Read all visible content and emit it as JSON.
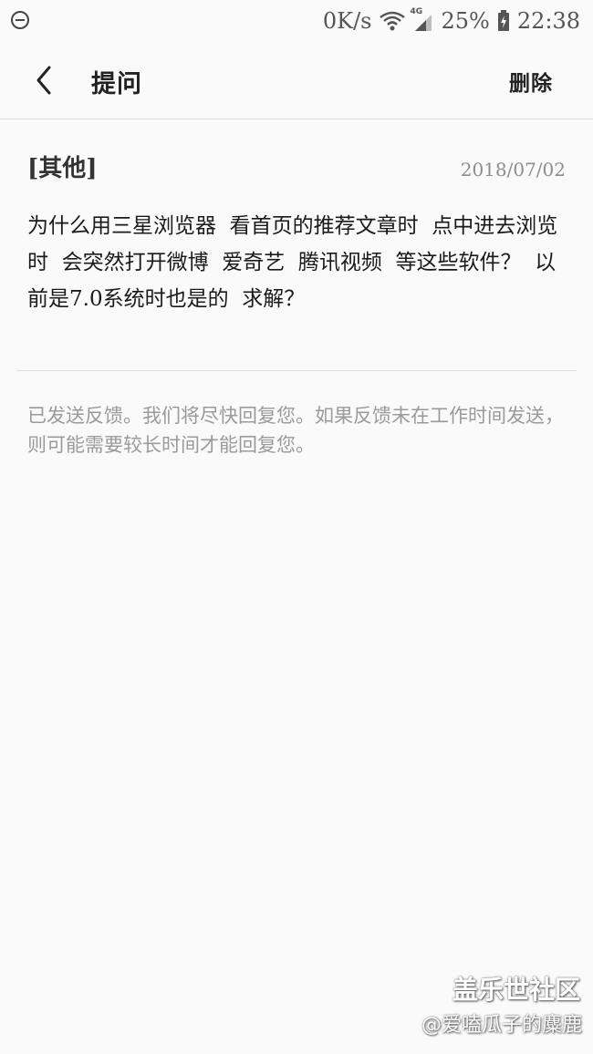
{
  "status_bar": {
    "speed": "0K/s",
    "network": "4G",
    "battery": "25%",
    "time": "22:38",
    "icons": [
      "do-not-disturb-icon",
      "wifi-icon",
      "signal-icon",
      "battery-icon"
    ]
  },
  "header": {
    "back_icon": "chevron-left-icon",
    "title": "提问",
    "delete_label": "删除"
  },
  "question": {
    "category": "[其他]",
    "date": "2018/07/02",
    "body": "为什么用三星浏览器  看首页的推荐文章时  点中进去浏览时  会突然打开微博  爱奇艺  腾讯视频  等这些软件？  以前是7.0系统时也是的  求解？"
  },
  "notice": "已发送反馈。我们将尽快回复您。如果反馈未在工作时间发送，则可能需要较长时间才能回复您。",
  "watermark": {
    "logo": "盖乐世社区",
    "user": "@爱嗑瓜子的麋鹿"
  }
}
